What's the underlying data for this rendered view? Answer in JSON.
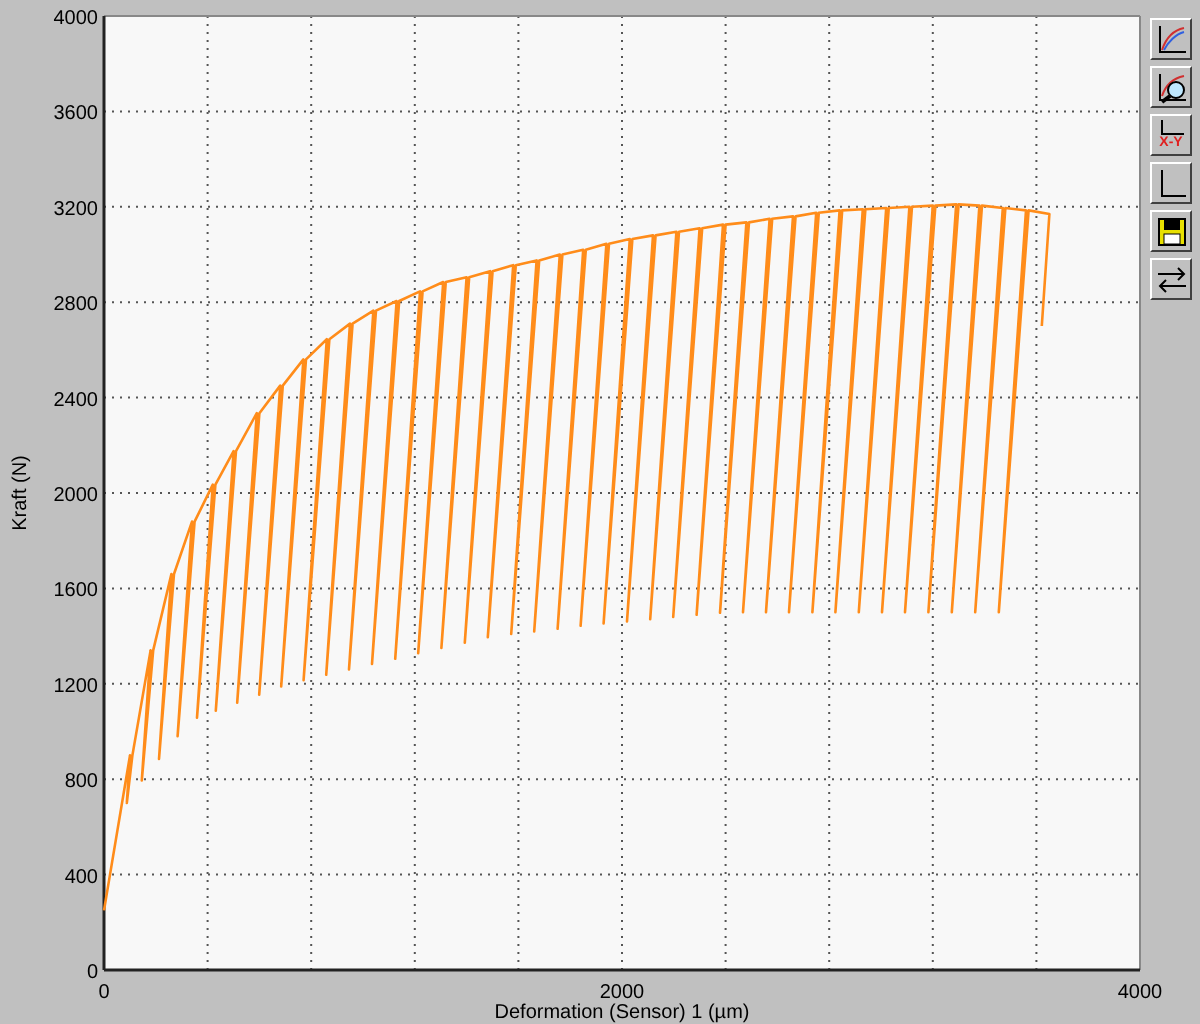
{
  "chart": {
    "chart_data": {
      "type": "line",
      "grid": true,
      "xlabel": "Deformation (Sensor) 1 (µm)",
      "ylabel": "Kraft (N)",
      "xlim": [
        0,
        4000
      ],
      "ylim": [
        0,
        4000
      ],
      "xticks": [
        0,
        2000,
        4000
      ],
      "yticks": [
        0,
        400,
        800,
        1200,
        1600,
        2000,
        2400,
        2800,
        3200,
        3600,
        4000
      ],
      "x": [
        0,
        100,
        88,
        110,
        180,
        146,
        190,
        260,
        212,
        270,
        340,
        284,
        350,
        420,
        359,
        430,
        500,
        432,
        510,
        590,
        514,
        600,
        680,
        599,
        690,
        770,
        684,
        780,
        860,
        771,
        870,
        950,
        858,
        960,
        1040,
        946,
        1050,
        1130,
        1035,
        1140,
        1220,
        1124,
        1230,
        1310,
        1213,
        1320,
        1400,
        1303,
        1410,
        1490,
        1393,
        1500,
        1580,
        1482,
        1590,
        1670,
        1572,
        1680,
        1760,
        1661,
        1770,
        1850,
        1751,
        1860,
        1940,
        1840,
        1950,
        2030,
        1929,
        2040,
        2120,
        2019,
        2130,
        2210,
        2109,
        2220,
        2300,
        2198,
        2310,
        2390,
        2288,
        2400,
        2480,
        2378,
        2490,
        2570,
        2467,
        2580,
        2660,
        2556,
        2670,
        2750,
        2645,
        2760,
        2840,
        2735,
        2850,
        2930,
        2824,
        2940,
        3020,
        2914,
        3030,
        3110,
        3004,
        3120,
        3200,
        3093,
        3210,
        3290,
        3183,
        3300,
        3380,
        3273,
        3390,
        3470,
        3364,
        3480,
        3560,
        3455,
        3570,
        3650,
        3621
      ],
      "series": [
        {
          "color": "#ff8c1a",
          "values": [
            250,
            900,
            700,
            900,
            1340,
            795,
            1340,
            1660,
            885,
            1660,
            1880,
            980,
            1880,
            2035,
            1058,
            2035,
            2175,
            1088,
            2175,
            2335,
            1121,
            2335,
            2450,
            1155,
            2450,
            2560,
            1189,
            2560,
            2645,
            1215,
            2645,
            2710,
            1238,
            2710,
            2765,
            1260,
            2765,
            2805,
            1283,
            2805,
            2845,
            1305,
            2845,
            2885,
            1328,
            2885,
            2905,
            1350,
            2905,
            2930,
            1373,
            2930,
            2955,
            1395,
            2955,
            2975,
            1409,
            2975,
            3000,
            1420,
            3000,
            3020,
            1431,
            3020,
            3045,
            1443,
            3045,
            3065,
            1453,
            3065,
            3080,
            1462,
            3080,
            3095,
            1471,
            3095,
            3110,
            1480,
            3110,
            3125,
            1489,
            3125,
            3135,
            1498,
            3135,
            3150,
            1500,
            3150,
            3160,
            1500,
            3160,
            3175,
            1500,
            3175,
            3185,
            1500,
            3185,
            3190,
            1500,
            3190,
            3195,
            1500,
            3195,
            3200,
            1500,
            3200,
            3205,
            1500,
            3205,
            3210,
            1500,
            3210,
            3205,
            1500,
            3205,
            3195,
            1500,
            3195,
            3185,
            1500,
            3185,
            3170,
            2700
          ]
        }
      ]
    }
  },
  "toolbar": [
    {
      "kind": "zoom"
    },
    {
      "kind": "magnify"
    },
    {
      "kind": "xy",
      "label": "X-Y"
    },
    {
      "kind": "axes"
    },
    {
      "kind": "save"
    },
    {
      "kind": "swap"
    }
  ]
}
